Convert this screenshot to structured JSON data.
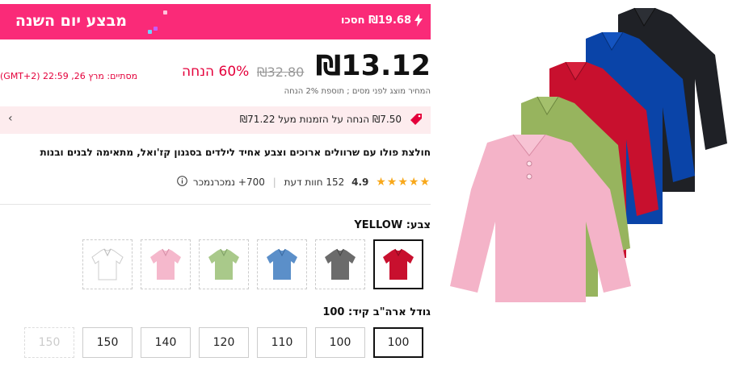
{
  "banner": {
    "title": "מבצע יום השנה",
    "save_text": "₪19.68 חסכו",
    "bolt_icon": "lightning-icon",
    "color": "#fa2a78"
  },
  "pricing": {
    "price": "₪13.12",
    "original_price": "₪32.80",
    "discount": "60% הנחה",
    "ends": "מסתיים:  מרץ 26, 22:59 (GMT+2)",
    "tax_note": "המחיר מוצג לפני מסים ; תוספת 2% הנחה"
  },
  "coupon": {
    "text": "₪7.50 הנחה על הזמנות מעל ₪71.22",
    "icon": "tag-icon"
  },
  "product": {
    "title": "חולצת פולו עם שרוולים ארוכים וצבע אחיד לילדים בסגנון קז'ואל, מתאימה לבנים ובנות"
  },
  "rating": {
    "stars": "★★★★★",
    "value": "4.9",
    "reviews": "152 חוות דעת",
    "sold": "700+ נמכרנמכר"
  },
  "color": {
    "label": "צבע: YELLOW",
    "swatches": [
      "#c8102e",
      "#6b6b6b",
      "#5b8fc9",
      "#a9c98a",
      "#f5b8cc",
      "#ffffff"
    ]
  },
  "size": {
    "label": "גודל ארה\"ב קיד: 100",
    "options": [
      "100",
      "100",
      "110",
      "120",
      "140",
      "150",
      "150"
    ]
  }
}
